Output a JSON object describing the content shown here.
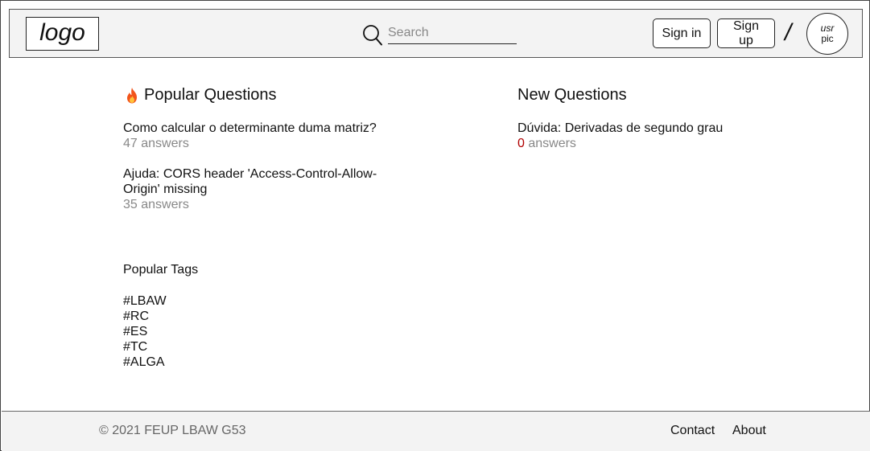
{
  "header": {
    "logo_text": "logo",
    "search_placeholder": "Search",
    "search_value": "",
    "sign_in_label": "Sign in",
    "sign_up_label": "Sign up",
    "separator": "/",
    "avatar_line1": "usr",
    "avatar_line2": "pic"
  },
  "popular": {
    "title": "Popular Questions",
    "icon": "fire-icon",
    "questions": [
      {
        "title": "Como calcular o determinante duma matriz?",
        "answers_text": "47 answers"
      },
      {
        "title": "Ajuda: CORS header 'Access-Control-Allow-Origin' missing",
        "answers_text": "35 answers"
      }
    ]
  },
  "new_questions": {
    "title": "New Questions",
    "questions": [
      {
        "title": "Dúvida: Derivadas de segundo grau",
        "answer_count": "0",
        "answers_word": " answers"
      }
    ]
  },
  "tags": {
    "title": "Popular Tags",
    "items": [
      "#LBAW",
      "#RC",
      "#ES",
      "#TC",
      "#ALGA"
    ]
  },
  "footer": {
    "copyright": "© 2021 FEUP LBAW G53",
    "contact_label": "Contact",
    "about_label": "About"
  },
  "colors": {
    "header_bg": "#f3f3f3",
    "muted_text": "#888888",
    "zero_count": "#b00000"
  }
}
